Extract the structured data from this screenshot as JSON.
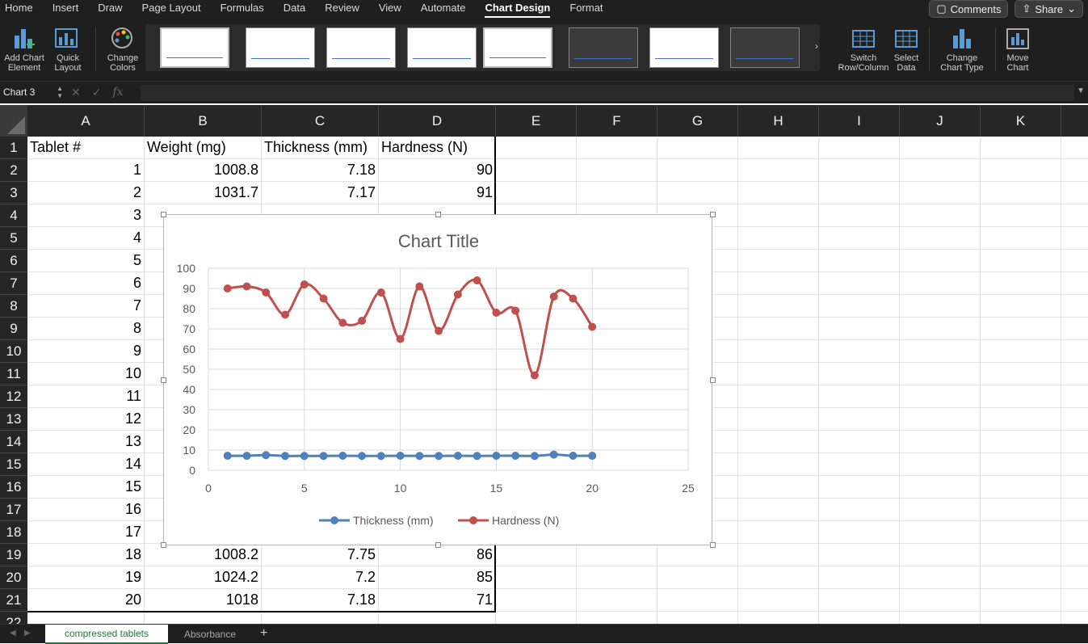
{
  "ribbon": {
    "tabs": [
      "Home",
      "Insert",
      "Draw",
      "Page Layout",
      "Formulas",
      "Data",
      "Review",
      "View",
      "Automate",
      "Chart Design",
      "Format"
    ],
    "active_tab": "Chart Design",
    "comments_label": "Comments",
    "share_label": "Share",
    "buttons": {
      "add_chart_element": [
        "Add Chart",
        "Element"
      ],
      "quick_layout": [
        "Quick",
        "Layout"
      ],
      "change_colors": [
        "Change",
        "Colors"
      ],
      "switch_row_col": [
        "Switch",
        "Row/Column"
      ],
      "select_data": [
        "Select",
        "Data"
      ],
      "change_chart_type": [
        "Change",
        "Chart Type"
      ],
      "move_chart": [
        "Move",
        "Chart"
      ]
    }
  },
  "formula_bar": {
    "name_box": "Chart 3",
    "fx": "fx",
    "content": ""
  },
  "columns": [
    "A",
    "B",
    "C",
    "D",
    "E",
    "F",
    "G",
    "H",
    "I",
    "J",
    "K"
  ],
  "rows": [
    "1",
    "2",
    "3",
    "4",
    "5",
    "6",
    "7",
    "8",
    "9",
    "10",
    "11",
    "12",
    "13",
    "14",
    "15",
    "16",
    "17",
    "18",
    "19",
    "20",
    "21",
    "22"
  ],
  "headers": [
    "Tablet #",
    "Weight (mg)",
    "Thickness (mm)",
    "Hardness (N)"
  ],
  "visible_rows": [
    [
      "1",
      "1008.8",
      "7.18",
      "90"
    ],
    [
      "2",
      "1031.7",
      "7.17",
      "91"
    ],
    [
      "3",
      "",
      "",
      ""
    ],
    [
      "4",
      "",
      "",
      ""
    ],
    [
      "5",
      "",
      "",
      ""
    ],
    [
      "6",
      "",
      "",
      ""
    ],
    [
      "7",
      "",
      "",
      ""
    ],
    [
      "8",
      "",
      "",
      ""
    ],
    [
      "9",
      "",
      "",
      ""
    ],
    [
      "10",
      "",
      "",
      ""
    ],
    [
      "11",
      "",
      "",
      ""
    ],
    [
      "12",
      "",
      "",
      ""
    ],
    [
      "13",
      "",
      "",
      ""
    ],
    [
      "14",
      "",
      "",
      ""
    ],
    [
      "15",
      "",
      "",
      ""
    ],
    [
      "16",
      "",
      "",
      ""
    ],
    [
      "17",
      "",
      "",
      ""
    ],
    [
      "18",
      "1008.2",
      "7.75",
      "86"
    ],
    [
      "19",
      "1024.2",
      "7.2",
      "85"
    ],
    [
      "20",
      "1018",
      "7.18",
      "71"
    ]
  ],
  "chart_data": {
    "type": "scatter",
    "title": "Chart Title",
    "xlabel": "",
    "ylabel": "",
    "xlim": [
      0,
      25
    ],
    "ylim": [
      0,
      100
    ],
    "xticks": [
      0,
      5,
      10,
      15,
      20,
      25
    ],
    "yticks": [
      0,
      10,
      20,
      30,
      40,
      50,
      60,
      70,
      80,
      90,
      100
    ],
    "grid": true,
    "legend": "bottom",
    "x": [
      1,
      2,
      3,
      4,
      5,
      6,
      7,
      8,
      9,
      10,
      11,
      12,
      13,
      14,
      15,
      16,
      17,
      18,
      19,
      20
    ],
    "series": [
      {
        "name": "Thickness (mm)",
        "color": "#4f81bd",
        "values": [
          7.18,
          7.17,
          7.5,
          7.1,
          7.1,
          7.1,
          7.2,
          7.1,
          7.1,
          7.2,
          7.1,
          7.1,
          7.2,
          7.1,
          7.2,
          7.2,
          7.1,
          7.75,
          7.2,
          7.18
        ]
      },
      {
        "name": "Hardness (N)",
        "color": "#c0504d",
        "values": [
          90,
          91,
          88,
          77,
          92,
          85,
          73,
          74,
          88,
          65,
          91,
          69,
          87,
          94,
          78,
          79,
          47,
          86,
          85,
          71
        ]
      }
    ]
  },
  "sheets": [
    "compressed tablets",
    "Absorbance"
  ],
  "active_sheet": "compressed tablets",
  "add_sheet": "+"
}
